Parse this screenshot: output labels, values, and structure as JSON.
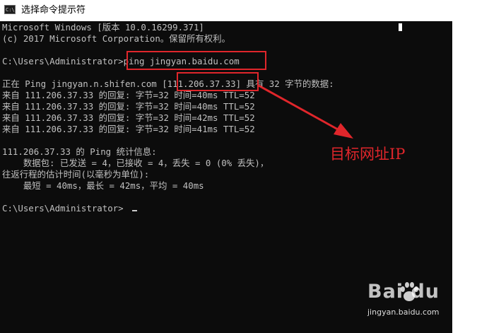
{
  "window": {
    "title": "选择命令提示符",
    "icon_text": "C:\\"
  },
  "console": {
    "lines": [
      "Microsoft Windows [版本 10.0.16299.371]",
      "(c) 2017 Microsoft Corporation。保留所有权利。",
      "",
      "C:\\Users\\Administrator>ping jingyan.baidu.com",
      "",
      "正在 Ping jingyan.n.shifen.com [111.206.37.33] 具有 32 字节的数据:",
      "来自 111.206.37.33 的回复: 字节=32 时间=40ms TTL=52",
      "来自 111.206.37.33 的回复: 字节=32 时间=40ms TTL=52",
      "来自 111.206.37.33 的回复: 字节=32 时间=42ms TTL=52",
      "来自 111.206.37.33 的回复: 字节=32 时间=41ms TTL=52",
      "",
      "111.206.37.33 的 Ping 统计信息:",
      "    数据包: 已发送 = 4，已接收 = 4，丢失 = 0 (0% 丢失)，",
      "往返行程的估计时间(以毫秒为单位):",
      "    最短 = 40ms，最长 = 42ms，平均 = 40ms",
      "",
      "C:\\Users\\Administrator>"
    ]
  },
  "annotation": {
    "label": "目标网址IP",
    "color": "#e0262b"
  },
  "watermark": {
    "brand": "Bai  du",
    "sub": "jingyan.baidu.com"
  },
  "colors": {
    "console_bg": "#0c0c0c",
    "console_text": "#c0c0c0"
  }
}
